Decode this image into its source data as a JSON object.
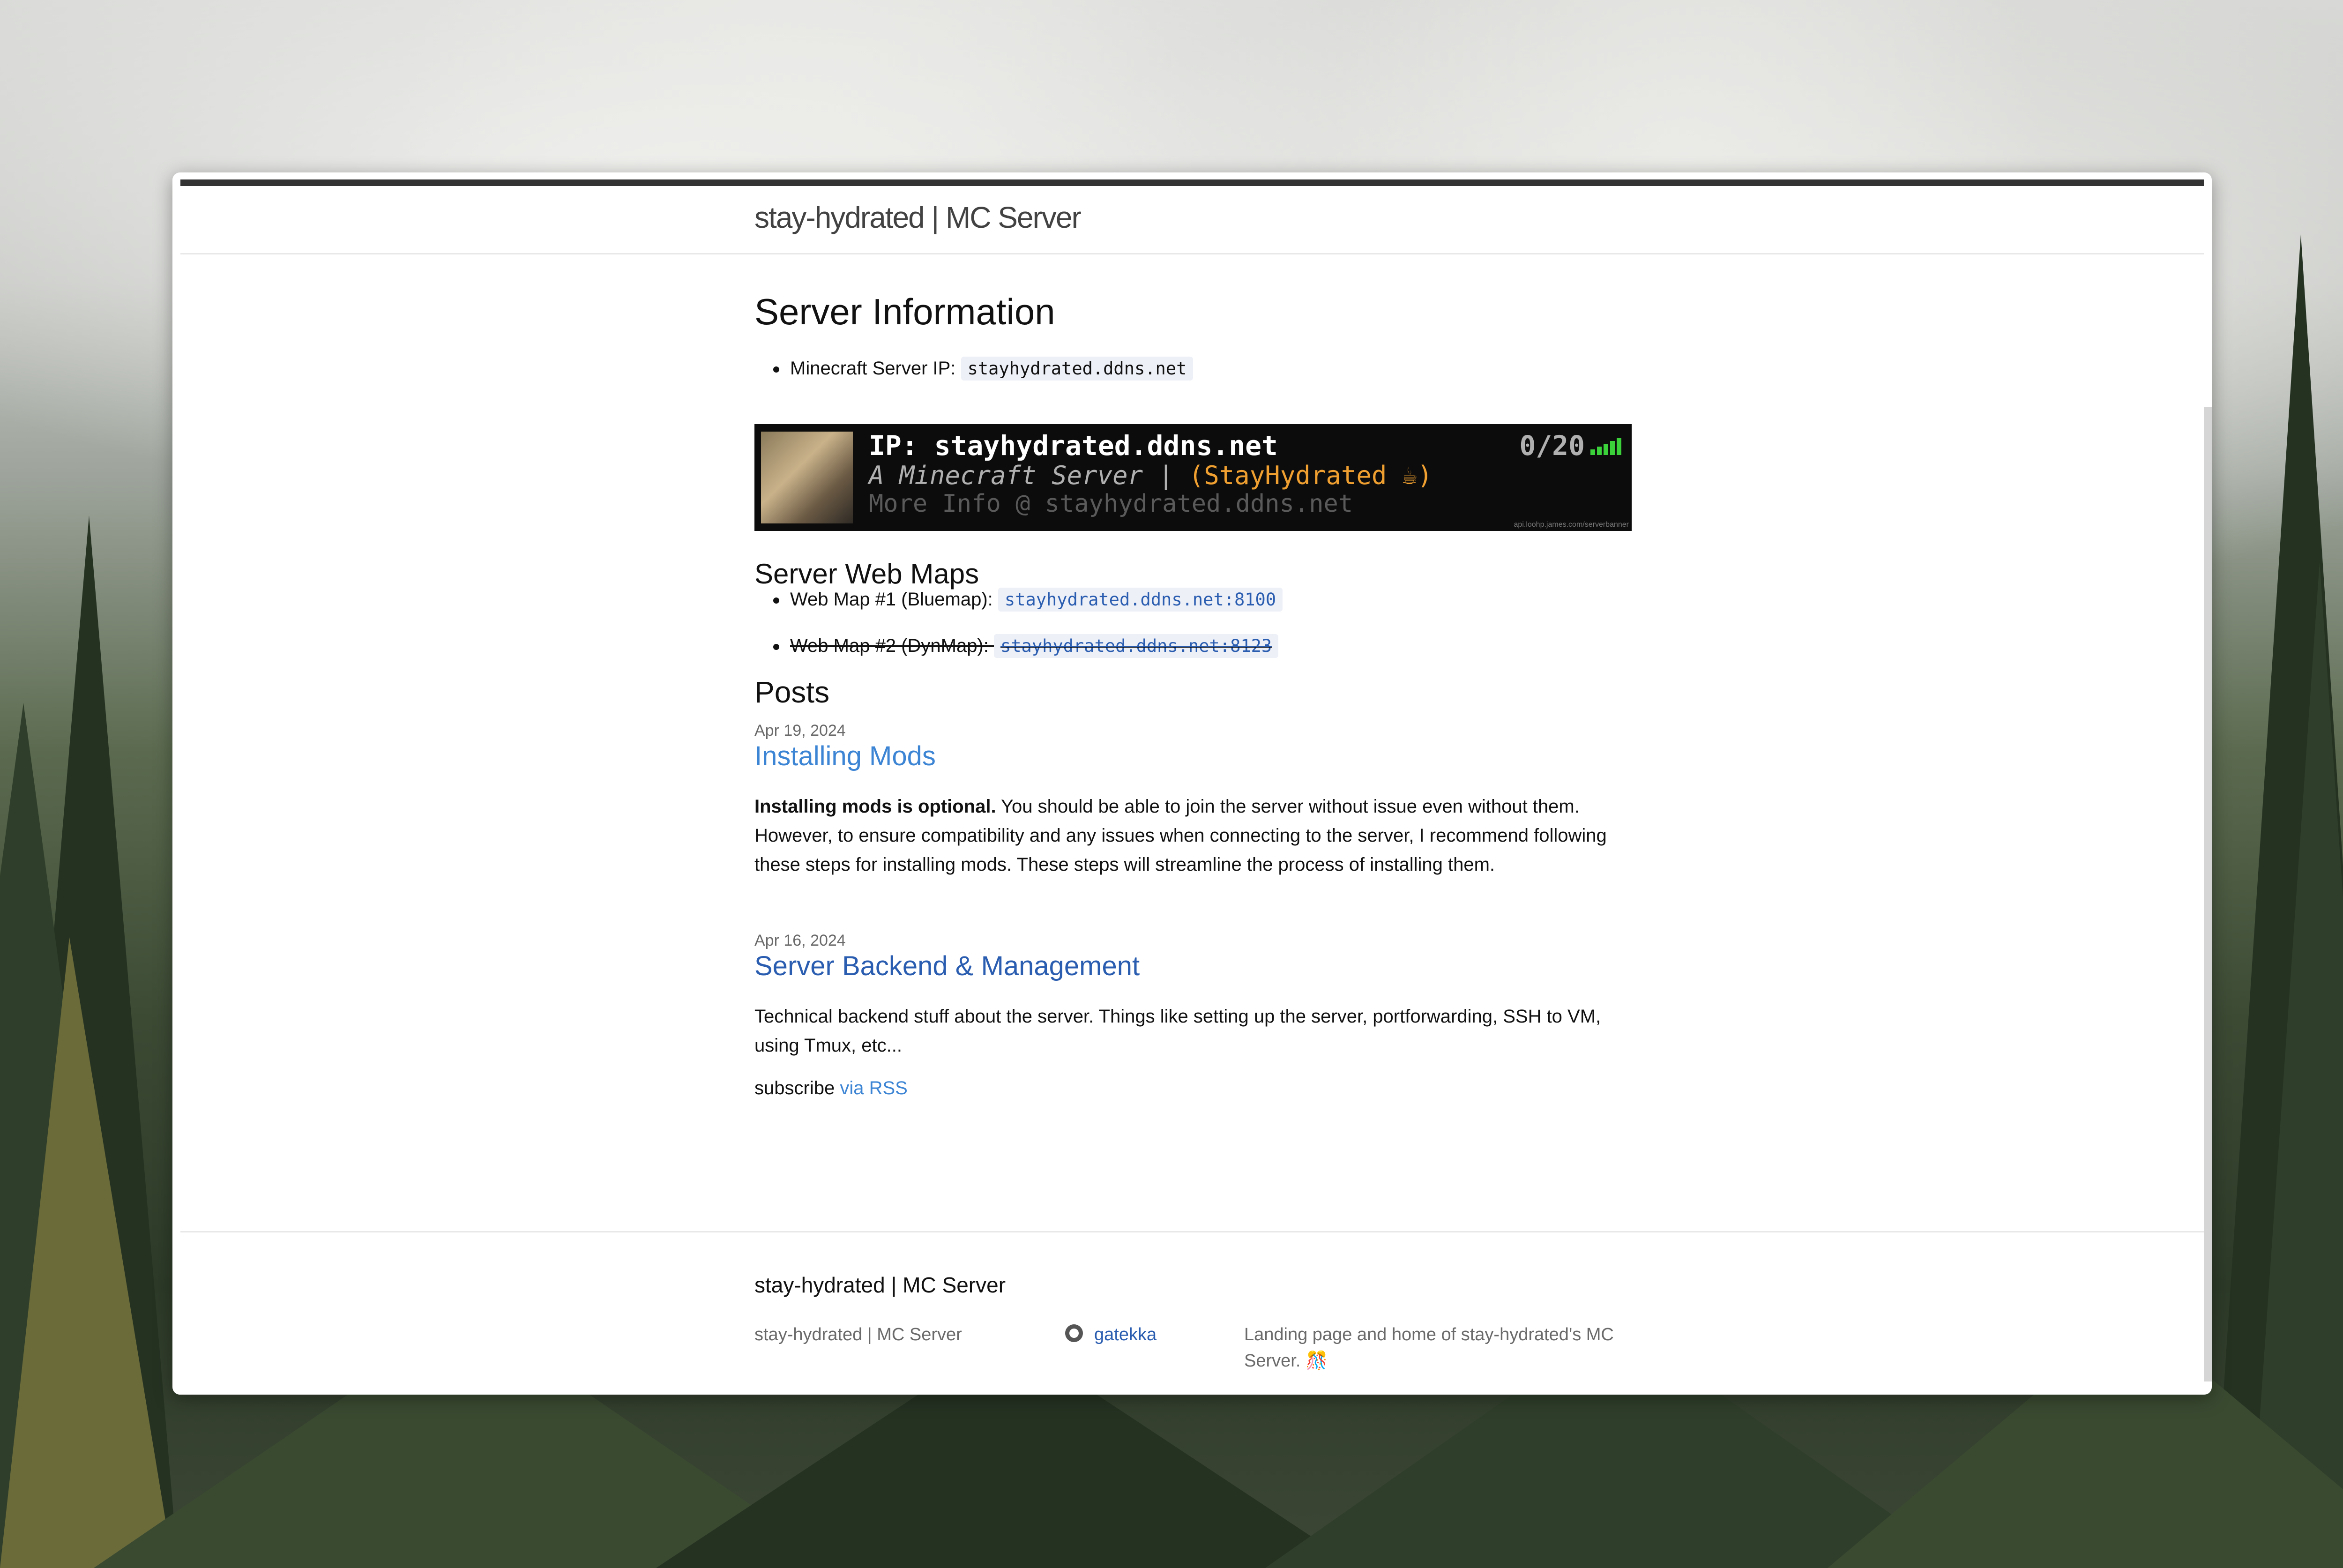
{
  "header": {
    "site_title": "stay-hydrated | MC Server"
  },
  "server_info": {
    "heading": "Server Information",
    "ip_label": "Minecraft Server IP:",
    "ip_value": "stayhydrated.ddns.net"
  },
  "banner": {
    "line1": "IP: stayhydrated.ddns.net",
    "line2_prefix": "A Minecraft Server | ",
    "line2_highlight": "(StayHydrated ☕)",
    "line3": "More Info @ stayhydrated.ddns.net",
    "player_count": "0/20",
    "credit": "api.loohp.james.com/serverbanner"
  },
  "web_maps": {
    "heading": "Server Web Maps",
    "items": [
      {
        "label": "Web Map #1 (Bluemap):",
        "link": "stayhydrated.ddns.net:8100",
        "struck": false
      },
      {
        "label": "Web Map #2 (DynMap):",
        "link": "stayhydrated.ddns.net:8123",
        "struck": true
      }
    ]
  },
  "posts": {
    "heading": "Posts",
    "items": [
      {
        "date": "Apr 19, 2024",
        "title": "Installing Mods",
        "excerpt_bold": "Installing mods is optional.",
        "excerpt": " You should be able to join the server without issue even without them. However, to ensure compatibility and any issues when connecting to the server, I recommend following these steps for installing mods. These steps will streamline the process of installing them."
      },
      {
        "date": "Apr 16, 2024",
        "title": "Server Backend & Management",
        "excerpt": "Technical backend stuff about the server. Things like setting up the server, portforwarding, SSH to VM, using Tmux, etc..."
      }
    ]
  },
  "subscribe": {
    "text": "subscribe",
    "link": "via RSS"
  },
  "footer": {
    "title": "stay-hydrated | MC Server",
    "col1": "stay-hydrated | MC Server",
    "github_user": "gatekka",
    "description": "Landing page and home of stay-hydrated's MC Server. 🎊"
  },
  "colors": {
    "link_light": "#3c84d4",
    "link_dark": "#2a5db0",
    "header_bar": "#333333"
  }
}
